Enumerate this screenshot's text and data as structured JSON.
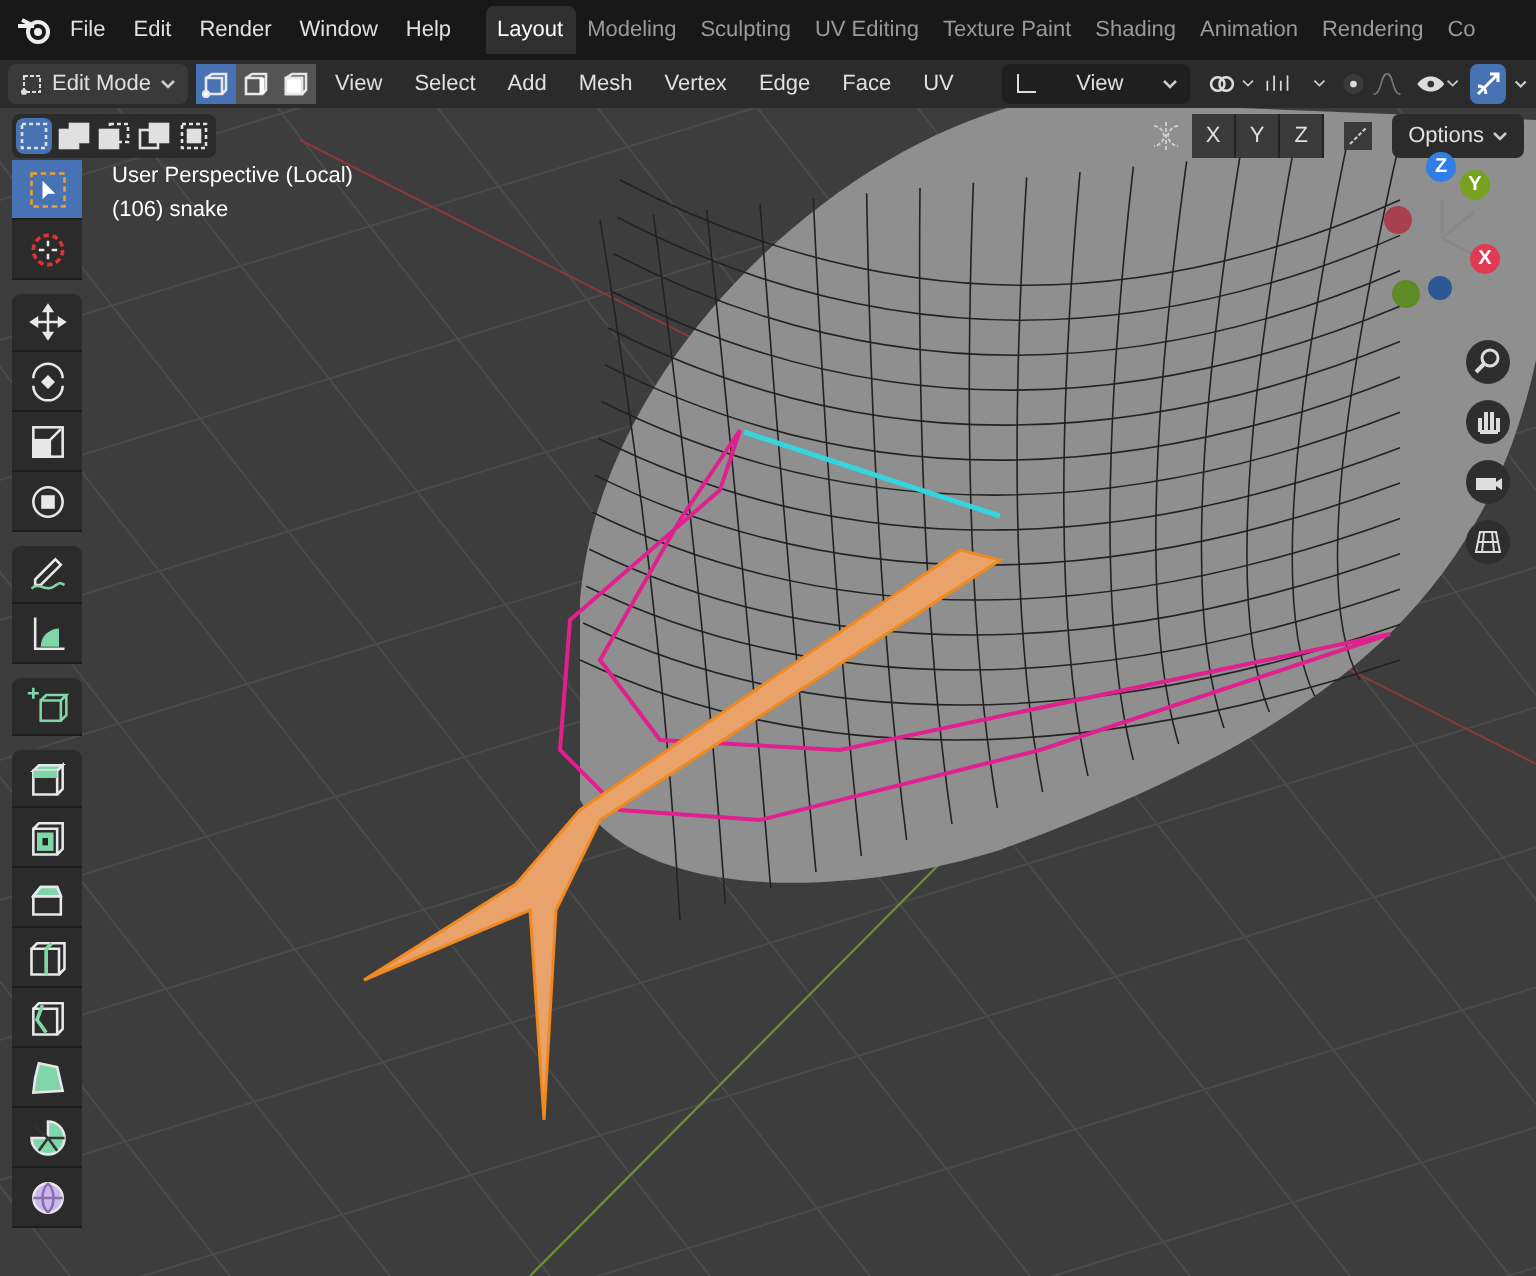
{
  "menu": [
    "File",
    "Edit",
    "Render",
    "Window",
    "Help"
  ],
  "workspaces": [
    {
      "label": "Layout",
      "selected": true
    },
    {
      "label": "Modeling",
      "selected": false
    },
    {
      "label": "Sculpting",
      "selected": false
    },
    {
      "label": "UV Editing",
      "selected": false
    },
    {
      "label": "Texture Paint",
      "selected": false
    },
    {
      "label": "Shading",
      "selected": false
    },
    {
      "label": "Animation",
      "selected": false
    },
    {
      "label": "Rendering",
      "selected": false
    },
    {
      "label": "Co",
      "selected": false
    }
  ],
  "header": {
    "mode": "Edit Mode",
    "select_modes": [
      {
        "kind": "vertex",
        "selected": true
      },
      {
        "kind": "edge",
        "selected": false
      },
      {
        "kind": "face",
        "selected": false
      }
    ],
    "menus": [
      "View",
      "Select",
      "Add",
      "Mesh",
      "Vertex",
      "Edge",
      "Face",
      "UV"
    ],
    "orientation": "View"
  },
  "select_tools": [
    {
      "kind": "set",
      "selected": true
    },
    {
      "kind": "extend",
      "selected": false
    },
    {
      "kind": "subtract",
      "selected": false
    },
    {
      "kind": "invert",
      "selected": false
    },
    {
      "kind": "intersect",
      "selected": false
    }
  ],
  "mirror_axes": [
    {
      "label": "X",
      "selected": false
    },
    {
      "label": "Y",
      "selected": false
    },
    {
      "label": "Z",
      "selected": false
    }
  ],
  "options": "Options",
  "viewport": {
    "view_name": "User Perspective (Local)",
    "object": "(106) snake"
  },
  "gizmo": [
    {
      "label": "Z",
      "color": "#2f7fe6"
    },
    {
      "label": "Y",
      "color": "#77a11f"
    },
    {
      "label": "X",
      "color": "#e23a52"
    }
  ],
  "tools": [
    {
      "kind": "select_box",
      "selected": true,
      "gap_before": false
    },
    {
      "kind": "cursor",
      "selected": false,
      "gap_before": false
    },
    {
      "kind": "move",
      "selected": false,
      "gap_before": true
    },
    {
      "kind": "rotate",
      "selected": false,
      "gap_before": false
    },
    {
      "kind": "scale",
      "selected": false,
      "gap_before": false
    },
    {
      "kind": "transform",
      "selected": false,
      "gap_before": false
    },
    {
      "kind": "annotate",
      "selected": false,
      "gap_before": true
    },
    {
      "kind": "measure",
      "selected": false,
      "gap_before": false
    },
    {
      "kind": "add_cube",
      "selected": false,
      "gap_before": true
    },
    {
      "kind": "extrude",
      "selected": false,
      "gap_before": true
    },
    {
      "kind": "inset",
      "selected": false,
      "gap_before": false
    },
    {
      "kind": "bevel",
      "selected": false,
      "gap_before": false
    },
    {
      "kind": "loop_cut",
      "selected": false,
      "gap_before": false
    },
    {
      "kind": "knife",
      "selected": false,
      "gap_before": false
    },
    {
      "kind": "poly_build",
      "selected": false,
      "gap_before": false
    },
    {
      "kind": "spin",
      "selected": false,
      "gap_before": false
    },
    {
      "kind": "smooth",
      "selected": false,
      "gap_before": false
    }
  ]
}
